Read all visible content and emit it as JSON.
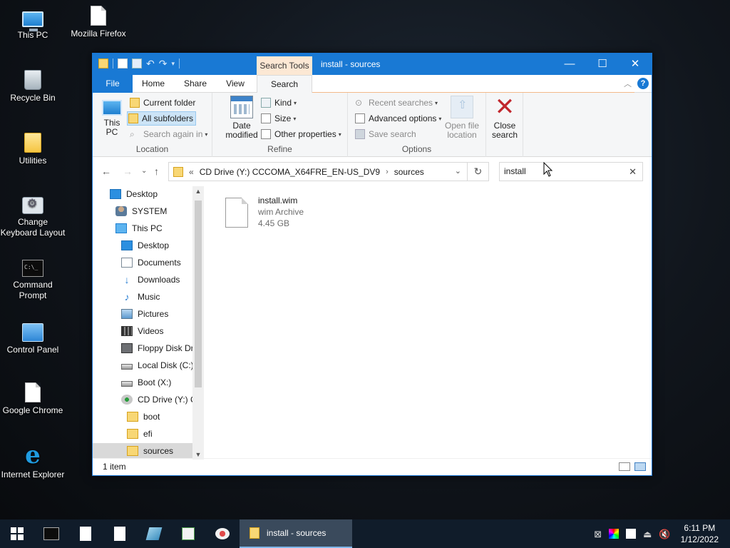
{
  "desktop": {
    "icons": [
      {
        "label": "This PC"
      },
      {
        "label": "Mozilla Firefox"
      },
      {
        "label": "Recycle Bin"
      },
      {
        "label": "Utilities"
      },
      {
        "label": "Change Keyboard Layout"
      },
      {
        "label": "Command Prompt"
      },
      {
        "label": "Control Panel"
      },
      {
        "label": "Google Chrome"
      },
      {
        "label": "Internet Explorer"
      }
    ]
  },
  "window": {
    "context_tab": "Search Tools",
    "title": "install - sources",
    "controls": {
      "minimize": "—",
      "maximize": "☐",
      "close": "✕"
    },
    "tabs": {
      "file": "File",
      "home": "Home",
      "share": "Share",
      "view": "View",
      "search": "Search"
    },
    "help": "?"
  },
  "ribbon": {
    "location": {
      "group_label": "Location",
      "this_pc": "This PC",
      "current_folder": "Current folder",
      "all_subfolders": "All subfolders",
      "search_again_in": "Search again in"
    },
    "refine": {
      "group_label": "Refine",
      "date_modified": "Date modified",
      "kind": "Kind",
      "size": "Size",
      "other_properties": "Other properties"
    },
    "options": {
      "group_label": "Options",
      "recent_searches": "Recent searches",
      "advanced_options": "Advanced options",
      "save_search": "Save search",
      "open_file_location": "Open file location"
    },
    "close_search": "Close search"
  },
  "address": {
    "prefix": "«",
    "path": [
      "CD Drive (Y:) CCCOMA_X64FRE_EN-US_DV9",
      "sources"
    ],
    "search_value": "install"
  },
  "nav_pane": {
    "items": [
      {
        "label": "Desktop",
        "icon": "desktop-icon"
      },
      {
        "label": "SYSTEM",
        "icon": "user-icon"
      },
      {
        "label": "This PC",
        "icon": "pc-icon"
      },
      {
        "label": "Desktop",
        "icon": "desktop-icon"
      },
      {
        "label": "Documents",
        "icon": "documents-icon"
      },
      {
        "label": "Downloads",
        "icon": "downloads-icon"
      },
      {
        "label": "Music",
        "icon": "music-icon"
      },
      {
        "label": "Pictures",
        "icon": "pictures-icon"
      },
      {
        "label": "Videos",
        "icon": "videos-icon"
      },
      {
        "label": "Floppy Disk Dri",
        "icon": "floppy-icon"
      },
      {
        "label": "Local Disk (C:)",
        "icon": "disk-icon"
      },
      {
        "label": "Boot (X:)",
        "icon": "disk-icon"
      },
      {
        "label": "CD Drive (Y:) C",
        "icon": "cd-icon"
      },
      {
        "label": "boot",
        "icon": "folder-icon"
      },
      {
        "label": "efi",
        "icon": "folder-icon"
      },
      {
        "label": "sources",
        "icon": "folder-icon"
      }
    ]
  },
  "results": [
    {
      "name": "install.wim",
      "type": "wim Archive",
      "size": "4.45 GB"
    }
  ],
  "status": {
    "count": "1 item"
  },
  "taskbar": {
    "active_window": "install - sources",
    "time": "6:11 PM",
    "date": "1/12/2022"
  },
  "colors": {
    "accent": "#1979d4",
    "context_tab": "#fce8d4",
    "taskbar": "#101c2a"
  }
}
